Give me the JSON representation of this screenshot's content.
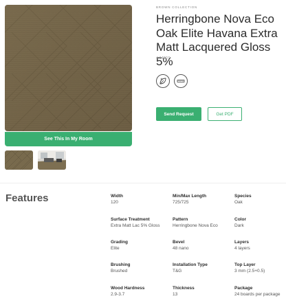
{
  "product": {
    "collection": "BROWN COLLECTION",
    "title": "Herringbone Nova Eco Oak Elite Havana Extra Matt Lacquered Gloss 5%",
    "sku": "# 14507",
    "icons": [
      "leaf-care-icon",
      "ruler-icon"
    ]
  },
  "buttons": {
    "room": "See This In My Room",
    "send": "Send Request",
    "pdf": "Get PDF"
  },
  "features": {
    "heading": "Features",
    "items": [
      {
        "label": "Width",
        "value": "120"
      },
      {
        "label": "Min/Max Length",
        "value": "725/725"
      },
      {
        "label": "Species",
        "value": "Oak"
      },
      {
        "label": "Surface Treatment",
        "value": "Extra Matt Lac 5% Gloss"
      },
      {
        "label": "Pattern",
        "value": "Herringbone Nova Eco"
      },
      {
        "label": "Color",
        "value": "Dark"
      },
      {
        "label": "Grading",
        "value": "Elite"
      },
      {
        "label": "Bevel",
        "value": "48 nano"
      },
      {
        "label": "Layers",
        "value": "4 layers"
      },
      {
        "label": "Brushing",
        "value": "Brushed"
      },
      {
        "label": "Installation Type",
        "value": "T&G"
      },
      {
        "label": "Top Layer",
        "value": "3 mm (2.5+0.5)"
      },
      {
        "label": "Wood Hardness",
        "value": "2.9-3.7"
      },
      {
        "label": "Thickness",
        "value": "13"
      },
      {
        "label": "Package",
        "value": "24 boards per package"
      }
    ]
  },
  "colors": {
    "accent": "#3aaf71",
    "wood": "#7a6a4c"
  }
}
